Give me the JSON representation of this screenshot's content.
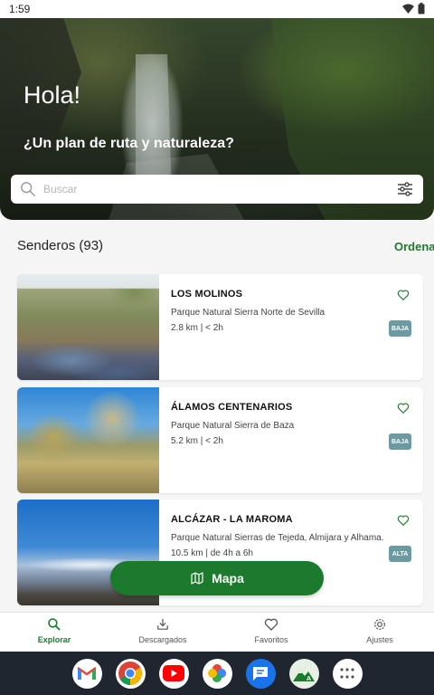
{
  "status_bar": {
    "time": "1:59"
  },
  "hero": {
    "greeting": "Hola!",
    "subtitle": "¿Un plan de ruta y naturaleza?",
    "search": {
      "placeholder": "Buscar",
      "value": ""
    }
  },
  "trails": {
    "title": "Senderos (93)",
    "sort_label": "Ordenar",
    "items": [
      {
        "name": "LOS MOLINOS",
        "park": "Parque Natural Sierra Norte de Sevilla",
        "meta": "2.8 km | < 2h",
        "difficulty": "BAJA",
        "favorite": false
      },
      {
        "name": "ÁLAMOS CENTENARIOS",
        "park": "Parque Natural Sierra de Baza",
        "meta": "5.2 km | < 2h",
        "difficulty": "BAJA",
        "favorite": false
      },
      {
        "name": "ALCÁZAR - LA MAROMA",
        "park": "Parque Natural Sierras de Tejeda, Almijara y Alhama.",
        "meta": "10.5 km | de 4h a 6h",
        "difficulty": "ALTA",
        "favorite": false
      }
    ]
  },
  "map_button": {
    "label": "Mapa"
  },
  "bottom_nav": {
    "items": [
      {
        "label": "Explorar",
        "icon": "search-icon",
        "active": true
      },
      {
        "label": "Descargados",
        "icon": "download-icon",
        "active": false
      },
      {
        "label": "Favoritos",
        "icon": "heart-icon",
        "active": false
      },
      {
        "label": "Ajustes",
        "icon": "settings-icon",
        "active": false
      }
    ]
  },
  "dock": {
    "apps": [
      "gmail-icon",
      "chrome-icon",
      "youtube-icon",
      "photos-icon",
      "messages-icon",
      "trails-app-icon",
      "app-drawer-icon"
    ]
  },
  "colors": {
    "accent": "#1b7a2c",
    "badge": "#6c9aa3"
  }
}
